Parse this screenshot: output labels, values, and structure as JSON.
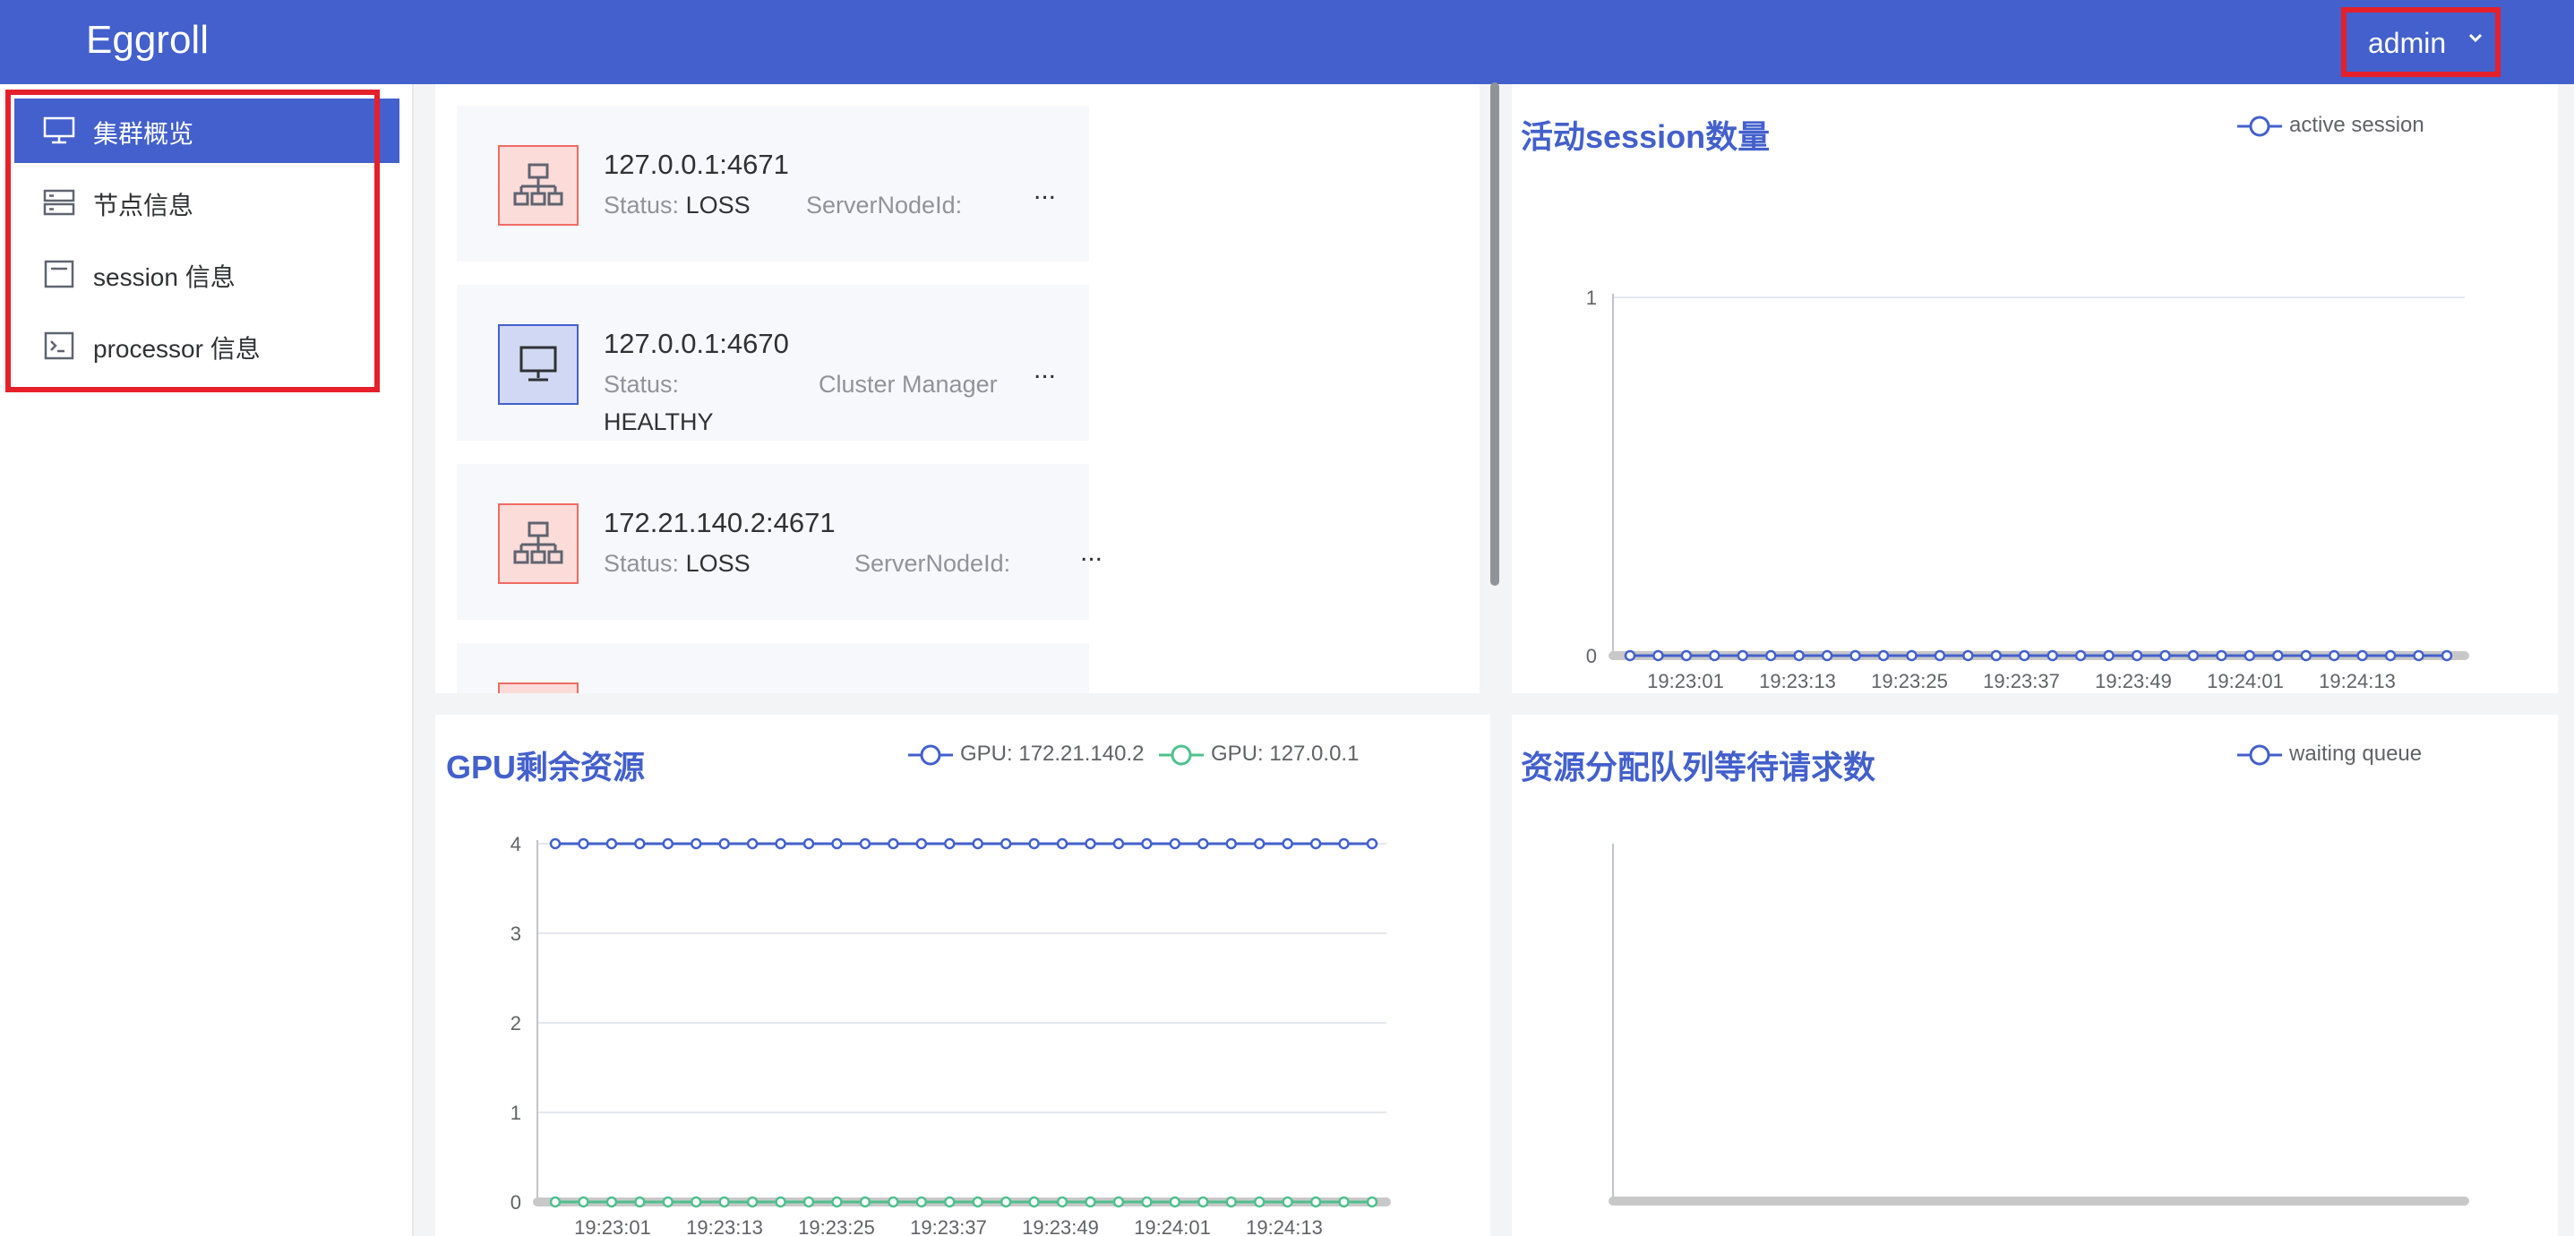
{
  "app": {
    "title": "Eggroll",
    "user": "admin"
  },
  "sidebar": {
    "items": [
      {
        "label": "集群概览",
        "icon": "monitor-icon",
        "active": true
      },
      {
        "label": "节点信息",
        "icon": "server-icon",
        "active": false
      },
      {
        "label": "session 信息",
        "icon": "document-icon",
        "active": false
      },
      {
        "label": "processor 信息",
        "icon": "terminal-icon",
        "active": false
      }
    ]
  },
  "nodes": [
    {
      "address": "127.0.0.1:4671",
      "status_label": "Status:",
      "status": "LOSS",
      "role": "ServerNodeId:",
      "more": "...",
      "icon": "network-icon"
    },
    {
      "address": "127.0.0.1:4670",
      "status_label": "Status:",
      "status": "HEALTHY",
      "role": "Cluster Manager",
      "more": "...",
      "icon": "monitor-icon"
    },
    {
      "address": "172.21.140.2:4671",
      "status_label": "Status:",
      "status": "LOSS",
      "role": "ServerNodeId:",
      "more": "...",
      "icon": "network-icon"
    }
  ],
  "colors": {
    "accent": "#4360cc",
    "green": "#4fc08d",
    "red_highlight": "#e5202a"
  },
  "chart_data": [
    {
      "type": "line",
      "title": "活动session数量",
      "x": [
        "19:23:01",
        "19:23:13",
        "19:23:25",
        "19:23:37",
        "19:23:49",
        "19:24:01",
        "19:24:13"
      ],
      "series": [
        {
          "name": "active session",
          "values": [
            0,
            0,
            0,
            0,
            0,
            0,
            0,
            0,
            0,
            0,
            0,
            0,
            0,
            0,
            0,
            0,
            0,
            0,
            0,
            0,
            0,
            0,
            0,
            0,
            0,
            0,
            0,
            0,
            0,
            0
          ]
        }
      ],
      "yticks": [
        "0",
        "1"
      ],
      "ylim": [
        0,
        1
      ],
      "legend": "top-right",
      "grid": true
    },
    {
      "type": "line",
      "title": "GPU剩余资源",
      "x": [
        "19:23:01",
        "19:23:13",
        "19:23:25",
        "19:23:37",
        "19:23:49",
        "19:24:01",
        "19:24:13"
      ],
      "series": [
        {
          "name": "GPU: 172.21.140.2",
          "values": [
            4,
            4,
            4,
            4,
            4,
            4,
            4,
            4,
            4,
            4,
            4,
            4,
            4,
            4,
            4,
            4,
            4,
            4,
            4,
            4,
            4,
            4,
            4,
            4,
            4,
            4,
            4,
            4,
            4,
            4
          ]
        },
        {
          "name": "GPU: 127.0.0.1",
          "values": [
            0,
            0,
            0,
            0,
            0,
            0,
            0,
            0,
            0,
            0,
            0,
            0,
            0,
            0,
            0,
            0,
            0,
            0,
            0,
            0,
            0,
            0,
            0,
            0,
            0,
            0,
            0,
            0,
            0,
            0
          ]
        }
      ],
      "yticks": [
        "0",
        "1",
        "2",
        "3",
        "4"
      ],
      "ylim": [
        0,
        4
      ],
      "legend": "top-right",
      "grid": true
    },
    {
      "type": "line",
      "title": "资源分配队列等待请求数",
      "x": [],
      "series": [
        {
          "name": "waiting queue",
          "values": []
        }
      ],
      "legend": "top-right",
      "grid": false
    }
  ]
}
